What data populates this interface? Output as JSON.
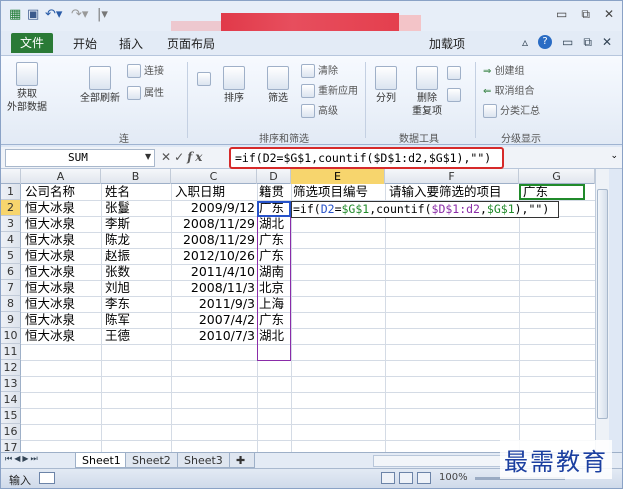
{
  "quick_access": {
    "app_icon": "excel-icon",
    "save_icon": "save-icon",
    "undo_icon": "undo-icon",
    "redo_icon": "redo-icon"
  },
  "tabs": {
    "file": "文件",
    "home": "开始",
    "insert": "插入",
    "page_layout": "页面布局",
    "addins": "加载项"
  },
  "ribbon": {
    "get_external": "获取\n外部数据",
    "refresh_all": "全部刷新",
    "connections": "连接",
    "properties": "属性",
    "sort": "排序",
    "filter": "筛选",
    "clear": "清除",
    "reapply": "重新应用",
    "advanced": "高级",
    "text_to_columns": "分列",
    "remove_dup": "删除\n重复项",
    "group": "创建组",
    "ungroup": "取消组合",
    "subtotal": "分类汇总",
    "grp_sort_filter": "排序和筛选",
    "grp_data_tools": "数据工具",
    "grp_outline": "分级显示",
    "grp_connections": "连"
  },
  "formula_bar": {
    "name_box": "SUM",
    "fx": "fx",
    "formula": "=if(D2=$G$1,countif($D$1:d2,$G$1),\"\")"
  },
  "columns": [
    "A",
    "B",
    "C",
    "D",
    "E",
    "F",
    "G"
  ],
  "rows": [
    "1",
    "2",
    "3",
    "4",
    "5",
    "6",
    "7",
    "8",
    "9",
    "10",
    "11",
    "12",
    "13",
    "14",
    "15",
    "16",
    "17"
  ],
  "header_row": {
    "a": "公司名称",
    "b": "姓名",
    "c": "入职日期",
    "d": "籍贯",
    "e": "筛选项目编号",
    "f": "请输入要筛选的项目",
    "g": "广东"
  },
  "data_rows": [
    {
      "a": "恒大冰泉",
      "b": "张鬘",
      "c": "2009/9/12",
      "d": "广东"
    },
    {
      "a": "恒大冰泉",
      "b": "李斯",
      "c": "2008/11/29",
      "d": "湖北"
    },
    {
      "a": "恒大冰泉",
      "b": "陈龙",
      "c": "2008/11/29",
      "d": "广东"
    },
    {
      "a": "恒大冰泉",
      "b": "赵振",
      "c": "2012/10/26",
      "d": "广东"
    },
    {
      "a": "恒大冰泉",
      "b": "张数",
      "c": "2011/4/10",
      "d": "湖南"
    },
    {
      "a": "恒大冰泉",
      "b": "刘旭",
      "c": "2008/11/3",
      "d": "北京"
    },
    {
      "a": "恒大冰泉",
      "b": "李东",
      "c": "2011/9/3",
      "d": "上海"
    },
    {
      "a": "恒大冰泉",
      "b": "陈军",
      "c": "2007/4/2",
      "d": "广东"
    },
    {
      "a": "恒大冰泉",
      "b": "王德",
      "c": "2010/7/3",
      "d": "湖北"
    }
  ],
  "edit_cell": {
    "p1": "=if(",
    "p2": "D2",
    "p3": "=",
    "p4": "$G$1",
    "p5": ",countif(",
    "p6": "$D$1:d2",
    "p7": ",",
    "p8": "$G$1",
    "p9": "),\"\")"
  },
  "sheets": [
    "Sheet1",
    "Sheet2",
    "Sheet3"
  ],
  "status": {
    "mode": "输入",
    "zoom": "100%"
  },
  "watermark": "最需教育",
  "colors": {
    "accent": "#2a7a36",
    "highlight_red": "#d62a2a",
    "ref_blue": "#2652c9",
    "ref_green": "#208a2a",
    "ref_purple": "#8a2ca8"
  }
}
